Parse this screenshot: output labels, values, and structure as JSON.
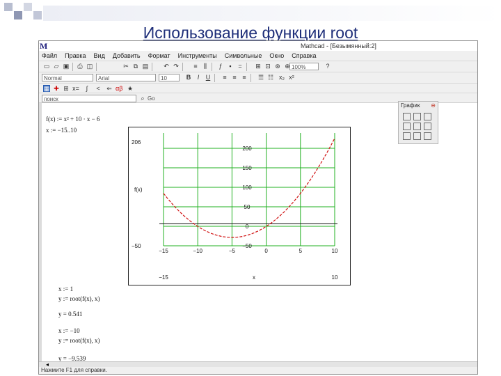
{
  "slide": {
    "title": "Использование функции root"
  },
  "app": {
    "logo": "M",
    "window_title": "Mathcad - [Безымянный:2]"
  },
  "menu": [
    "Файл",
    "Правка",
    "Вид",
    "Добавить",
    "Формат",
    "Инструменты",
    "Символьные",
    "Окно",
    "Справка"
  ],
  "toolbar": {
    "style_combo": "Normal",
    "font_combo": "Arial",
    "size_combo": "10",
    "zoom_combo": "100%"
  },
  "resource_bar": {
    "search_value": "поиск",
    "go_label": "Go"
  },
  "worksheet": {
    "func_def": "f(x) := x² + 10 · x − 6",
    "range_def": "x := −15..10",
    "guess1": "x := 1",
    "root1": "y := root(f(x), x)",
    "result1": "y = 0.541",
    "guess2": "x := −10",
    "root2": "y := root(f(x), x)",
    "result2": "y = −9.539"
  },
  "plot": {
    "y_top": "206",
    "y_bottom": "−50",
    "y_label": "f(x)",
    "x_min": "−15",
    "x_max": "10",
    "x_label": "x"
  },
  "graph_panel": {
    "title": "График"
  },
  "status": {
    "text": "Нажмите F1 для справки."
  },
  "colors": {
    "curve": "#d01010",
    "grid": "#22b022",
    "title": "#1f2f7a"
  },
  "chart_data": {
    "type": "line",
    "function": "x^2 + 10x - 6",
    "x_range": [
      -15,
      10
    ],
    "y_range": [
      -50,
      206
    ],
    "inner_y_ticks": [
      "200",
      "150",
      "100",
      "50",
      "0",
      "−50"
    ],
    "inner_x_ticks": [
      "−15",
      "−10",
      "−5",
      "0",
      "5",
      "10"
    ],
    "roots": [
      0.541,
      -9.539
    ]
  }
}
